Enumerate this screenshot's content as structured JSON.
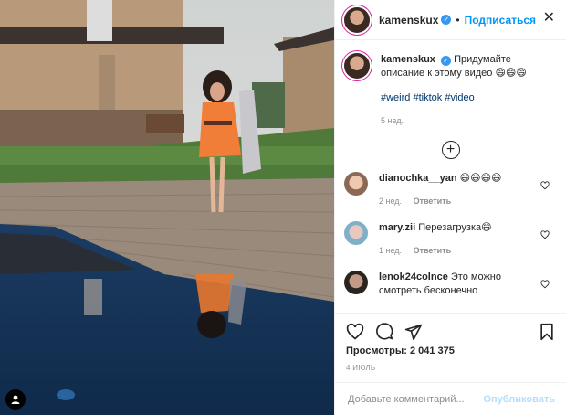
{
  "header": {
    "username": "kamenskux",
    "dot": "•",
    "follow_label": "Подписаться",
    "close_label": "✕"
  },
  "caption": {
    "username": "kamenskux",
    "text": "Придумайте описание к этому видео 😄😄😄",
    "hashtags": [
      "#weird",
      "#tiktok",
      "#video"
    ],
    "time": "5 нед."
  },
  "comments": [
    {
      "username": "dianochka__yan",
      "text": "😄😄😄😄",
      "time": "2 нед.",
      "reply": "Ответить"
    },
    {
      "username": "mary.zii",
      "text": "Перезагрузка😄",
      "time": "1 нед.",
      "reply": "Ответить"
    },
    {
      "username": "lenok24colnce",
      "text": "Это можно смотреть бесконечно",
      "time": "",
      "reply": ""
    }
  ],
  "stats": {
    "views": "Просмотры: 2 041 375",
    "date": "4 ИЮЛЬ"
  },
  "add_comment": {
    "placeholder": "Добавьте комментарий...",
    "publish_label": "Опубликовать"
  },
  "colors": {
    "accent": "#0095f6",
    "link": "#00376b",
    "muted": "#8e8e8e"
  }
}
